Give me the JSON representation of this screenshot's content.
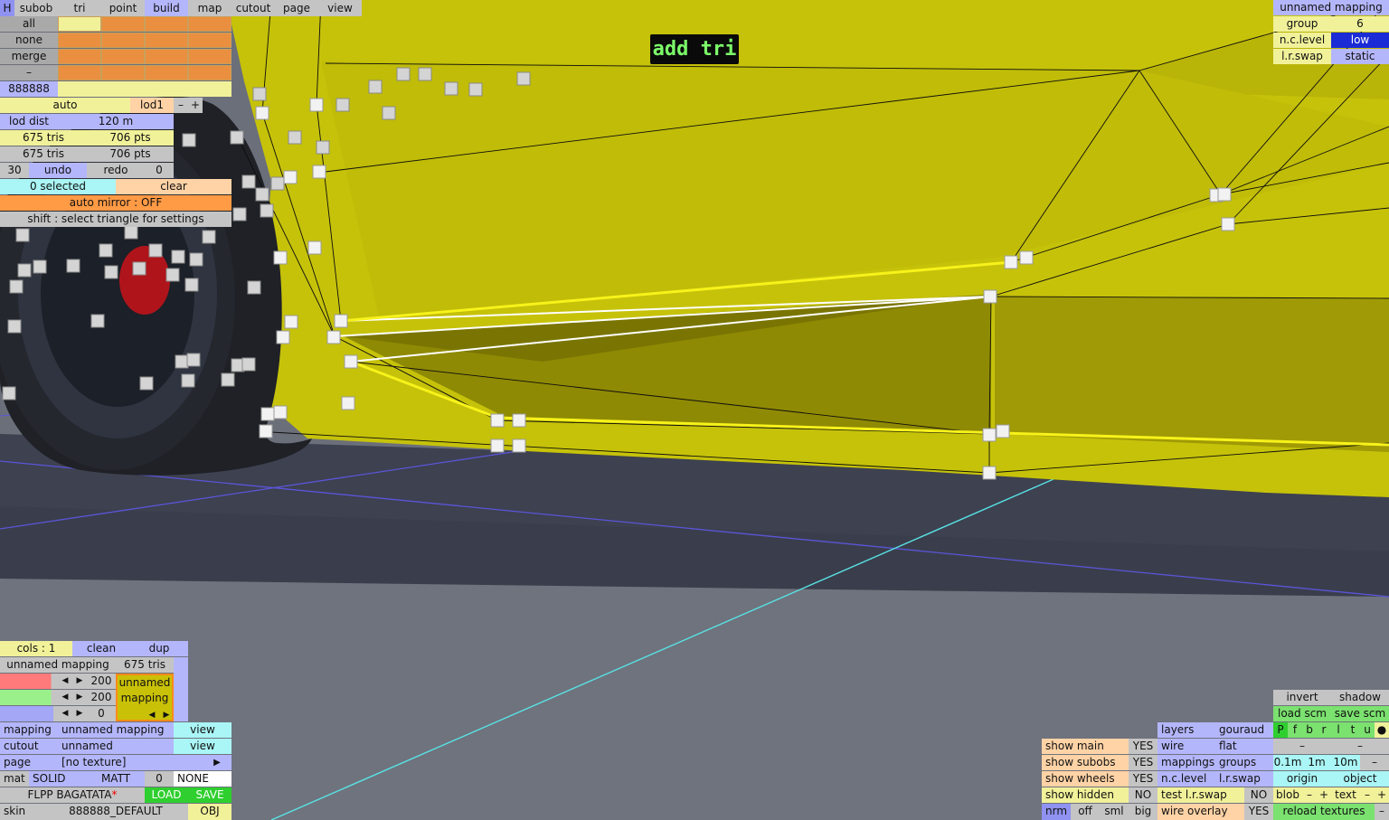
{
  "overlay_message": "add tri",
  "topbar": {
    "h": "H",
    "tabs": [
      "subob",
      "tri",
      "point",
      "build",
      "map",
      "cutout",
      "page",
      "view"
    ],
    "active_tab": "build"
  },
  "select_panel": {
    "all": "all",
    "none": "none",
    "merge": "merge",
    "dash": "–",
    "color_code": "888888"
  },
  "lod_panel": {
    "auto": "auto",
    "lod": "lod1",
    "minus": "–",
    "plus": "+",
    "lod_dist_label": "lod dist",
    "lod_dist_value": "120 m",
    "tris_a": "675 tris",
    "pts_a": "706 pts",
    "tris_b": "675 tris",
    "pts_b": "706 pts",
    "undo_count": "30",
    "undo": "undo",
    "redo": "redo",
    "redo_count": "0"
  },
  "selection": {
    "selected": "0 selected",
    "clear": "clear",
    "auto_mirror": "auto mirror : OFF",
    "hint": "shift : select triangle for settings"
  },
  "mapping_panel": {
    "title": "unnamed mapping",
    "group_label": "group",
    "group_value": "6",
    "nc_label": "n.c.level",
    "nc_value": "low",
    "lr_label": "l.r.swap",
    "lr_value": "static"
  },
  "bottom_left": {
    "cols": "cols : 1",
    "clean": "clean",
    "dup": "dup",
    "mapping_name": "unnamed mapping",
    "mapping_tris": "675 tris",
    "val1": "200",
    "val2": "200",
    "val3": "0",
    "preview_line1": "unnamed",
    "preview_line2": "mapping",
    "mapping_label": "mapping",
    "mapping_value": "unnamed mapping",
    "view1": "view",
    "cutout_label": "cutout",
    "cutout_value": "unnamed",
    "view2": "view",
    "page_label": "page",
    "page_value": "[no texture]",
    "page_arrow": "▶",
    "mat_label": "mat",
    "mat_solid": "SOLID",
    "mat_matt": "MATT",
    "mat_num": "0",
    "mat_none": "NONE",
    "car_name": "FLPP BAGATATA",
    "star": "*",
    "load": "LOAD",
    "save": "SAVE",
    "skin_label": "skin",
    "skin_value": "888888_DEFAULT",
    "obj": "OBJ",
    "arrow_left": "◀",
    "arrow_right": "▶"
  },
  "bottom_right": {
    "invert": "invert",
    "shadow": "shadow",
    "load_scm": "load scm",
    "save_scm": "save scm",
    "letters": [
      "P",
      "f",
      "b",
      "r",
      "l",
      "t",
      "u",
      "●"
    ],
    "layers": "layers",
    "gouraud": "gouraud",
    "wire": "wire",
    "flat": "flat",
    "mappings": "mappings",
    "groups": "groups",
    "nclevel": "n.c.level",
    "lrswap": "l.r.swap",
    "test_lr": "test l.r.swap",
    "no1": "NO",
    "wire_overlay": "wire overlay",
    "yes_wo": "YES",
    "show_main": "show main",
    "show_subobs": "show subobs",
    "show_wheels": "show wheels",
    "show_hidden": "show hidden",
    "yes1": "YES",
    "yes2": "YES",
    "yes3": "YES",
    "no2": "NO",
    "nrm": "nrm",
    "off": "off",
    "sml": "sml",
    "big": "big",
    "dash": "–",
    "d01": "0.1m",
    "d1": "1m",
    "d10": "10m",
    "origin": "origin",
    "object": "object",
    "blob": "blob",
    "text": "text",
    "minus": "–",
    "plus": "+",
    "reload": "reload textures"
  },
  "colors": {
    "body_yellow": "#c6c20a",
    "ground": "#6b6f7a",
    "accent_blue": "#b4b6fb",
    "accent_orange": "#ff9a45"
  }
}
